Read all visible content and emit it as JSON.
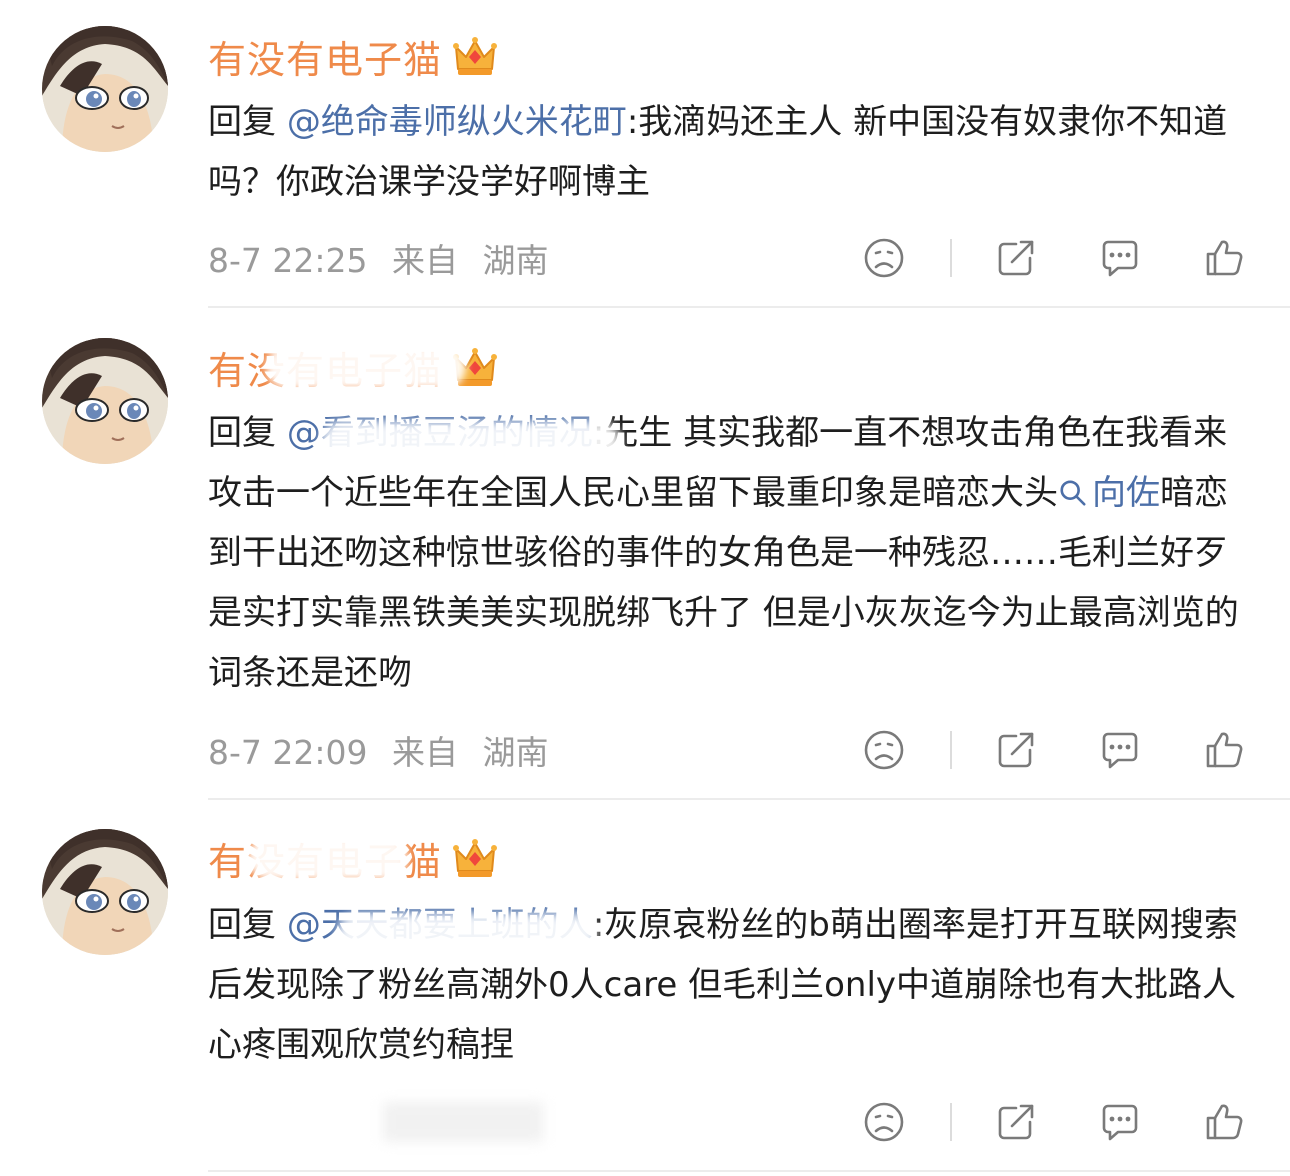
{
  "comments": [
    {
      "username": "有没有电子猫",
      "reply_prefix": "回复",
      "mention": "@绝命毒师纵火米花町",
      "text_parts": [
        ":我滴妈还主人 新中国没有奴隶你不知道吗？你政治课学没学好啊博主"
      ],
      "topic": "",
      "text_after_topic": "",
      "date": "8-7 22:25",
      "source_label": "来自",
      "location": "湖南"
    },
    {
      "username": "有没有电子猫",
      "reply_prefix": "回复",
      "mention": "@看到播豆汤的情况",
      "text_parts": [
        ":先生 其实我都一直不想攻击角色在我看来攻击一个近些年在全国人民心里留下最重印象是暗恋大头"
      ],
      "topic": "向佐",
      "text_after_topic": "暗恋到干出还吻这种惊世骇俗的事件的女角色是一种残忍……毛利兰好歹是实打实靠黑铁美美实现脱绑飞升了 但是小灰灰迄今为止最高浏览的词条还是还吻",
      "date": "8-7 22:09",
      "source_label": "来自",
      "location": "湖南"
    },
    {
      "username": "有没有电子猫",
      "reply_prefix": "回复",
      "mention": "@天天都要上班的人",
      "text_parts": [
        ":灰原哀粉丝的b萌出圈率是打开互联网搜索后发现除了粉丝高潮外0人care 但毛利兰only中道崩除也有大批路人心疼围观欣赏约稿捏"
      ],
      "topic": "",
      "text_after_topic": "",
      "date": "",
      "source_label": "",
      "location": ""
    }
  ],
  "icons": {
    "dislike": "sad-face-icon",
    "share": "share-icon",
    "comment": "comment-bubble-icon",
    "like": "thumbs-up-icon",
    "badge": "crown-badge-icon",
    "search": "search-icon"
  },
  "colors": {
    "username": "#ef8a4a",
    "link": "#4c6fa8",
    "meta": "#9a9a9a",
    "text": "#1e1e1e"
  }
}
